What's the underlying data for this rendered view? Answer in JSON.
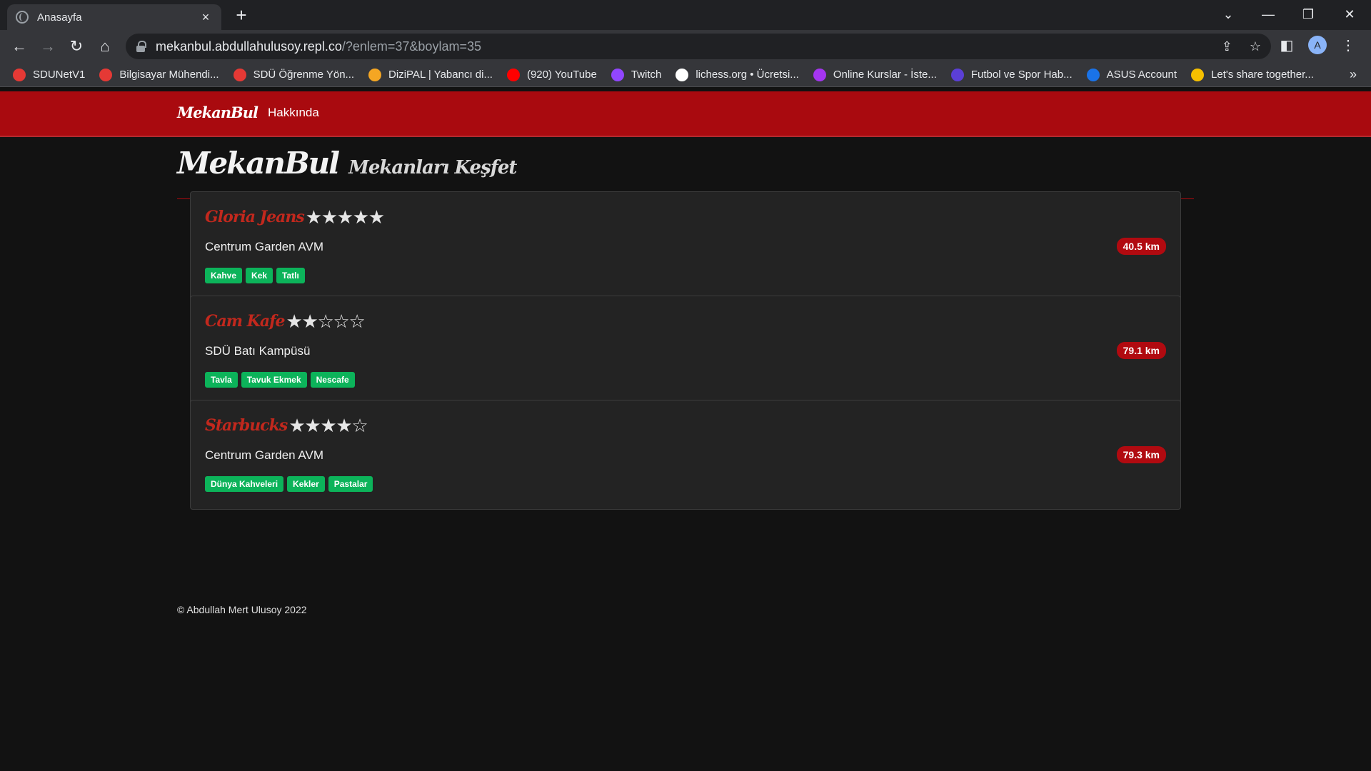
{
  "browser": {
    "tab_title": "Anasayfa",
    "tab_close": "×",
    "new_tab": "+",
    "url_host": "mekanbul.abdullahulusoy.repl.co",
    "url_path": "/?enlem=37&boylam=35",
    "profile_initial": "A",
    "bookmarks": [
      {
        "label": "SDUNetV1",
        "color": "#e53935"
      },
      {
        "label": "Bilgisayar Mühendi...",
        "color": "#e53935"
      },
      {
        "label": "SDÜ Öğrenme Yön...",
        "color": "#e53935"
      },
      {
        "label": "DiziPAL | Yabancı di...",
        "color": "#f5a623"
      },
      {
        "label": "(920) YouTube",
        "color": "#ff0000"
      },
      {
        "label": "Twitch",
        "color": "#9146ff"
      },
      {
        "label": "lichess.org • Ücretsi...",
        "color": "#ffffff"
      },
      {
        "label": "Online Kurslar - İste...",
        "color": "#a435f0"
      },
      {
        "label": "Futbol ve Spor Hab...",
        "color": "#5b3fd6"
      },
      {
        "label": "ASUS Account",
        "color": "#1a73e8"
      },
      {
        "label": "Let's share together...",
        "color": "#f6c000"
      }
    ],
    "more_bookmarks": "»"
  },
  "navbar": {
    "brand": "MekanBul",
    "link": "Hakkında"
  },
  "header": {
    "title": "MekanBul",
    "subtitle": "Mekanları Keşfet"
  },
  "venues": [
    {
      "name": "Gloria Jeans",
      "rating": 5,
      "address": "Centrum Garden AVM",
      "distance": "40.5 km",
      "tags": [
        "Kahve",
        "Kek",
        "Tatlı"
      ]
    },
    {
      "name": "Cam Kafe",
      "rating": 2,
      "address": "SDÜ Batı Kampüsü",
      "distance": "79.1 km",
      "tags": [
        "Tavla",
        "Tavuk Ekmek",
        "Nescafe"
      ]
    },
    {
      "name": "Starbucks",
      "rating": 4,
      "address": "Centrum Garden AVM",
      "distance": "79.3 km",
      "tags": [
        "Dünya Kahveleri",
        "Kekler",
        "Pastalar"
      ]
    }
  ],
  "footer": "© Abdullah Mert Ulusoy 2022",
  "colors": {
    "brand_red": "#a90a0f",
    "venue_name": "#c2281d",
    "tag_green": "#0cb35a"
  }
}
